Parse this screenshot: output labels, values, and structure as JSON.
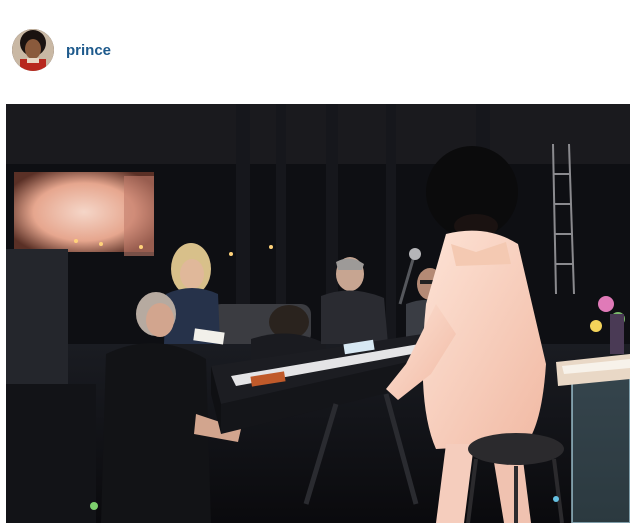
{
  "post": {
    "username": "prince",
    "avatar_icon": "profile-photo-icon",
    "photo_icon": "rehearsal-photo-icon",
    "colors": {
      "username": "#1e5a8c",
      "background": "#ffffff"
    }
  }
}
